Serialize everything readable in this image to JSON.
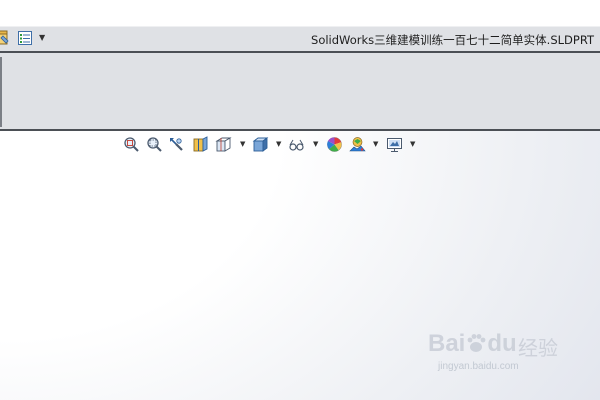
{
  "window": {
    "title": "SolidWorks三维建模训练一百七十二简单实体.SLDPRT"
  },
  "quick_access": {
    "items": [
      {
        "icon": "options-icon"
      },
      {
        "icon": "customize-list-icon"
      },
      {
        "icon": "dropdown-arrow-icon",
        "glyph": "▼"
      }
    ]
  },
  "view_toolbar": {
    "items": [
      {
        "icon": "zoom-to-fit-icon"
      },
      {
        "icon": "zoom-to-area-icon"
      },
      {
        "icon": "previous-view-icon"
      },
      {
        "icon": "section-view-icon"
      },
      {
        "icon": "view-orientation-icon"
      },
      {
        "icon": "display-style-icon"
      },
      {
        "icon": "hide-show-items-icon"
      },
      {
        "icon": "edit-appearance-icon"
      },
      {
        "icon": "apply-scene-icon"
      },
      {
        "icon": "view-settings-icon"
      }
    ],
    "dropdown_glyph": "▼"
  },
  "watermark": {
    "brand": "Bai",
    "brand_suffix": "du",
    "cn": "经验",
    "sub": "jingyan.baidu.com"
  },
  "colors": {
    "title_text": "#1e1e1e",
    "ribbon_bg": "#dfe1e5",
    "border": "#4b4f55",
    "graphics_fade": "#e3e6ee",
    "watermark": "#c8cdd6"
  }
}
